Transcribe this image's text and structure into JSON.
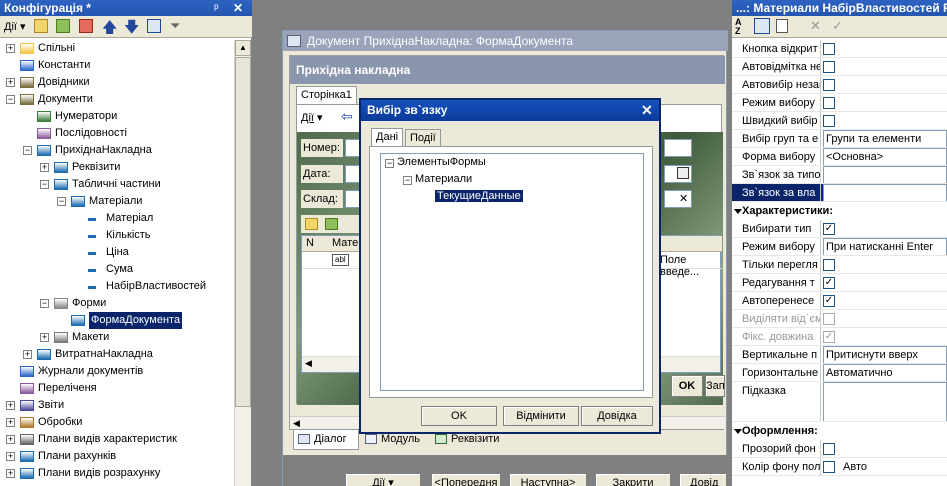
{
  "left_panel": {
    "title": "Конфігурація *",
    "pin": "ꟸ",
    "close": "✕",
    "actions_label": "Дії",
    "tree": [
      {
        "label": "Спільні",
        "level": 0,
        "pm": "+"
      },
      {
        "label": "Константи",
        "level": 0,
        "pm": ""
      },
      {
        "label": "Довідники",
        "level": 0,
        "pm": "+"
      },
      {
        "label": "Документи",
        "level": 0,
        "pm": "−"
      },
      {
        "label": "Нумератори",
        "level": 1,
        "pm": ""
      },
      {
        "label": "Послідовності",
        "level": 1,
        "pm": ""
      },
      {
        "label": "ПрихіднаНакладна",
        "level": 1,
        "pm": "−"
      },
      {
        "label": "Реквізити",
        "level": 2,
        "pm": "+"
      },
      {
        "label": "Табличні частини",
        "level": 2,
        "pm": "−"
      },
      {
        "label": "Матеріали",
        "level": 3,
        "pm": "−"
      },
      {
        "label": "Матеріал",
        "level": 4,
        "pm": ""
      },
      {
        "label": "Кількість",
        "level": 4,
        "pm": ""
      },
      {
        "label": "Ціна",
        "level": 4,
        "pm": ""
      },
      {
        "label": "Сума",
        "level": 4,
        "pm": ""
      },
      {
        "label": "НабірВластивостей",
        "level": 4,
        "pm": ""
      },
      {
        "label": "Форми",
        "level": 2,
        "pm": "−"
      },
      {
        "label": "ФормаДокумента",
        "level": 3,
        "pm": "",
        "selected": true
      },
      {
        "label": "Макети",
        "level": 2,
        "pm": "+"
      },
      {
        "label": "ВитратнаНакладна",
        "level": 1,
        "pm": "+"
      },
      {
        "label": "Журнали документів",
        "level": 0,
        "pm": ""
      },
      {
        "label": "Переліченя",
        "level": 0,
        "pm": ""
      },
      {
        "label": "Звіти",
        "level": 0,
        "pm": "+"
      },
      {
        "label": "Обробки",
        "level": 0,
        "pm": "+"
      },
      {
        "label": "Плани видів характеристик",
        "level": 0,
        "pm": "+"
      },
      {
        "label": "Плани рахунків",
        "level": 0,
        "pm": "+"
      },
      {
        "label": "Плани видів розрахунку",
        "level": 0,
        "pm": "+"
      }
    ]
  },
  "doc_window": {
    "title": "Документ ПрихіднаНакладна: ФормаДокумента",
    "header": "Прихідна накладна",
    "tab_page": "Сторінка1",
    "actions": "Дії",
    "fields": [
      "Номер:",
      "Дата:",
      "Склад:"
    ],
    "table_col_n": "N",
    "table_col_mat": "Матер",
    "table_cell_tag": "abl",
    "entry_hint": "Поле введе...",
    "ok": "OK",
    "save": "Запис",
    "bottom_tabs": [
      "Діалог",
      "Модуль",
      "Реквізити"
    ],
    "bottom_buttons": [
      "Дії",
      "<Попередня",
      "Наступна>",
      "Закрити",
      "Довід"
    ]
  },
  "dialog": {
    "title": "Вибір зв`язку",
    "close": "✕",
    "tabs": [
      "Дані",
      "Події"
    ],
    "tree": [
      "ЭлементыФормы",
      "Материали",
      "ТекущиеДанные"
    ],
    "ok": "OK",
    "cancel": "Відмінити",
    "help": "Довідка"
  },
  "props": {
    "title": "...: Материали НабірВластивостей Р",
    "rows": [
      {
        "label": "Кнопка відкрит",
        "type": "cb",
        "checked": false
      },
      {
        "label": "Автовідмітка не",
        "type": "cb",
        "checked": false
      },
      {
        "label": "Автовибір незап",
        "type": "cb",
        "checked": false
      },
      {
        "label": "Режим вибору",
        "type": "cb",
        "checked": false
      },
      {
        "label": "Швидкий вибір",
        "type": "cb",
        "checked": false
      },
      {
        "label": "Вибір груп та е",
        "type": "text",
        "value": "Групи та елементи"
      },
      {
        "label": "Форма вибору",
        "type": "text",
        "value": "<Основна>"
      },
      {
        "label": "Зв`язок за типо",
        "type": "text",
        "value": ""
      },
      {
        "label": "Зв`язок за вла",
        "type": "text",
        "value": "",
        "selected": true
      }
    ],
    "section_char": "Характеристики:",
    "rows2": [
      {
        "label": "Вибирати тип",
        "type": "cb",
        "checked": true
      },
      {
        "label": "Режим вибору",
        "type": "text",
        "value": "При натисканні Enter"
      },
      {
        "label": "Тільки перегля",
        "type": "cb",
        "checked": false
      },
      {
        "label": "Редагування т",
        "type": "cb",
        "checked": true
      },
      {
        "label": "Автоперенесе",
        "type": "cb",
        "checked": true
      },
      {
        "label": "Виділяти від`єм",
        "type": "cb",
        "checked": false,
        "disabled": true
      },
      {
        "label": "Фікс. довжина",
        "type": "cb",
        "checked": true,
        "disabled": true
      },
      {
        "label": "Вертикальне п",
        "type": "text",
        "value": "Притиснути вверх"
      },
      {
        "label": "Горизонтальне",
        "type": "text",
        "value": "Автоматично"
      },
      {
        "label": "Підказка",
        "type": "area",
        "value": ""
      }
    ],
    "section_design": "Оформлення:",
    "rows3": [
      {
        "label": "Прозорий фон",
        "type": "cb",
        "checked": false
      },
      {
        "label": "Колір фону пол",
        "type": "cbtext",
        "checked": false,
        "value": "Авто"
      }
    ]
  }
}
